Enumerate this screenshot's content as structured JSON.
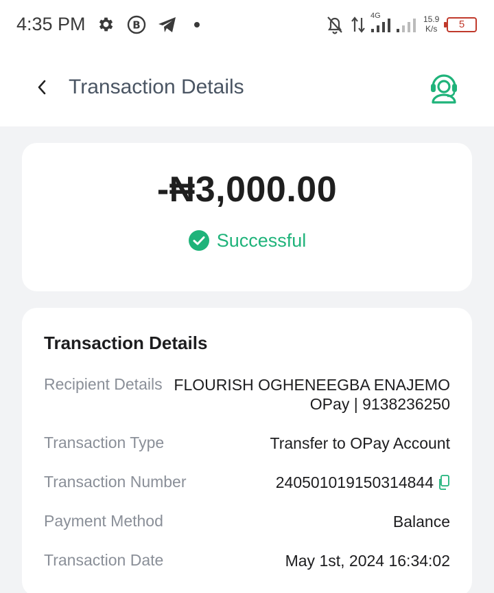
{
  "status_bar": {
    "time": "4:35 PM",
    "network_type": "4G",
    "speed_value": "15.9",
    "speed_unit": "K/s",
    "battery_level": "5",
    "icons": [
      "settings-icon",
      "b-circle-icon",
      "telegram-icon",
      "dot-icon",
      "bell-off-icon",
      "data-arrows-icon",
      "signal-icon",
      "signal-weak-icon",
      "battery-icon"
    ]
  },
  "header": {
    "title": "Transaction Details",
    "back_icon": "chevron-left-icon",
    "support_icon": "headset-agent-icon"
  },
  "summary": {
    "amount": "-₦3,000.00",
    "status": "Successful",
    "status_color": "#1fb37a"
  },
  "details": {
    "title": "Transaction Details",
    "recipient_label": "Recipient Details",
    "recipient_name": "FLOURISH OGHENEEGBA ENAJEMO",
    "recipient_account": "OPay | 9138236250",
    "type_label": "Transaction Type",
    "type_value": "Transfer to OPay Account",
    "number_label": "Transaction Number",
    "number_value": "240501019150314844",
    "method_label": "Payment Method",
    "method_value": "Balance",
    "date_label": "Transaction Date",
    "date_value": "May 1st, 2024 16:34:02"
  },
  "colors": {
    "accent": "#1fb37a",
    "page_bg": "#f2f3f5",
    "battery_low": "#c0392b"
  }
}
